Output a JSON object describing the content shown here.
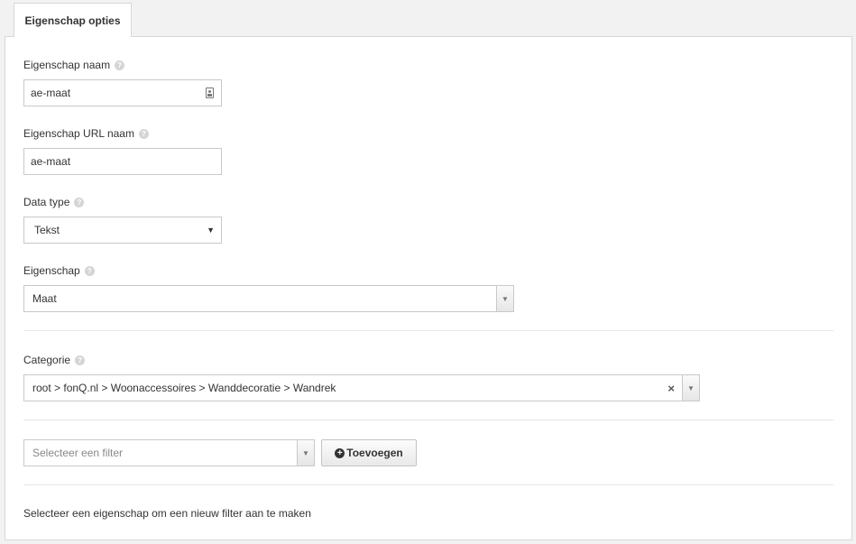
{
  "tab": {
    "label": "Eigenschap opties"
  },
  "fields": {
    "name": {
      "label": "Eigenschap naam",
      "value": "ae-maat"
    },
    "url_name": {
      "label": "Eigenschap URL naam",
      "value": "ae-maat"
    },
    "data_type": {
      "label": "Data type",
      "value": "Tekst"
    },
    "property": {
      "label": "Eigenschap",
      "value": "Maat"
    },
    "category": {
      "label": "Categorie",
      "value": "root > fonQ.nl > Woonaccessoires > Wanddecoratie > Wandrek"
    }
  },
  "filter": {
    "placeholder": "Selecteer een filter",
    "add_label": "Toevoegen"
  },
  "note": "Selecteer een eigenschap om een nieuw filter aan te maken",
  "help_glyph": "?",
  "icons": {
    "clear": "×",
    "dropdown": "▼",
    "contact": "contact-card-icon"
  }
}
